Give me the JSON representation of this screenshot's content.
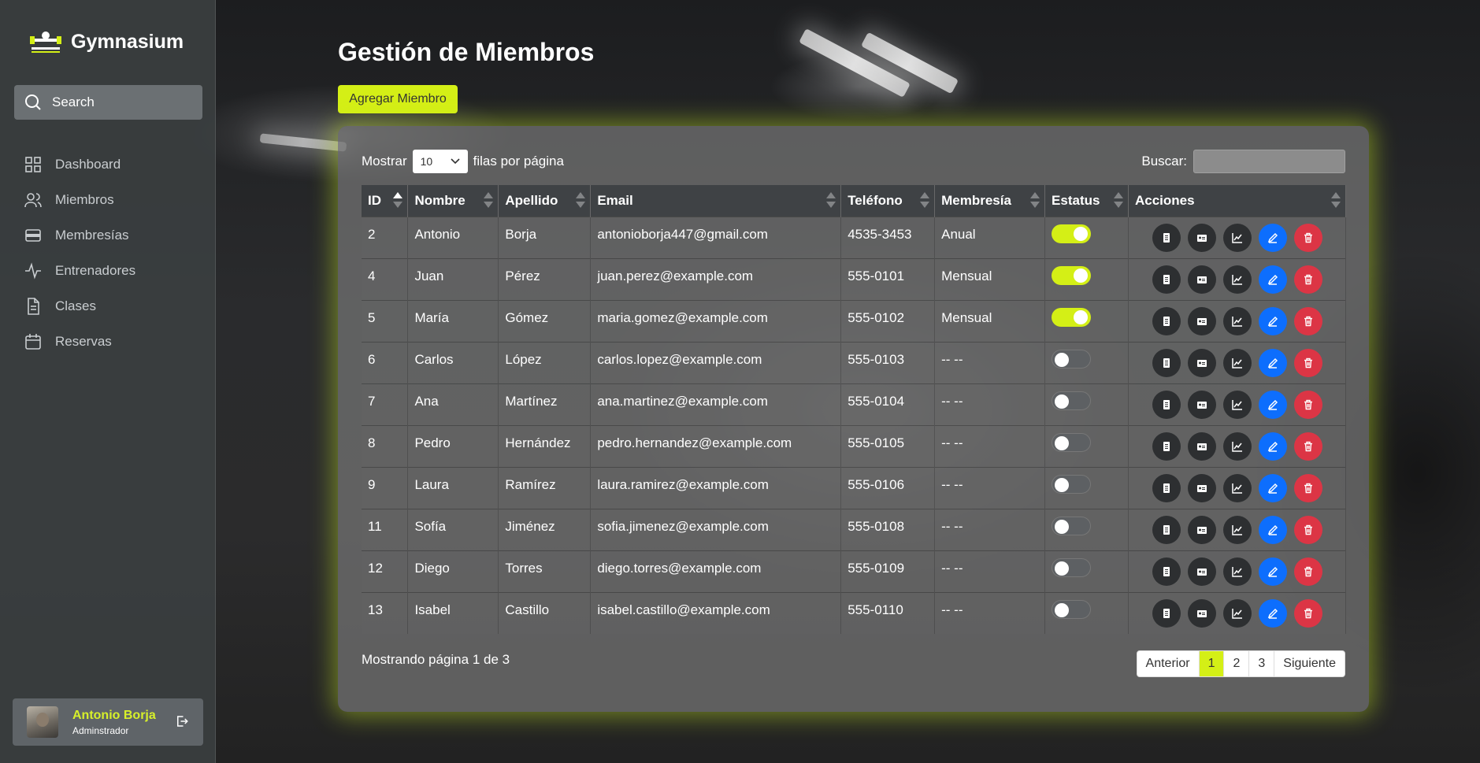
{
  "brand": {
    "name": "Gymnasium"
  },
  "sidebar": {
    "search_label": "Search",
    "items": [
      {
        "label": "Dashboard",
        "icon": "grid-icon"
      },
      {
        "label": "Miembros",
        "icon": "users-icon"
      },
      {
        "label": "Membresías",
        "icon": "card-icon"
      },
      {
        "label": "Entrenadores",
        "icon": "activity-icon"
      },
      {
        "label": "Clases",
        "icon": "document-icon"
      },
      {
        "label": "Reservas",
        "icon": "calendar-icon"
      }
    ]
  },
  "user": {
    "name": "Antonio Borja",
    "role": "Adminstrador"
  },
  "main": {
    "title": "Gestión de Miembros",
    "add_button": "Agregar Miembro",
    "show_prefix": "Mostrar",
    "show_value": "10",
    "show_suffix": "filas por página",
    "search_label": "Buscar:",
    "columns": [
      "ID",
      "Nombre",
      "Apellido",
      "Email",
      "Teléfono",
      "Membresía",
      "Estatus",
      "Acciones"
    ],
    "rows": [
      {
        "id": "2",
        "nombre": "Antonio",
        "apellido": "Borja",
        "email": "antonioborja447@gmail.com",
        "telefono": "4535-3453",
        "membresia": "Anual",
        "activo": true
      },
      {
        "id": "4",
        "nombre": "Juan",
        "apellido": "Pérez",
        "email": "juan.perez@example.com",
        "telefono": "555-0101",
        "membresia": "Mensual",
        "activo": true
      },
      {
        "id": "5",
        "nombre": "María",
        "apellido": "Gómez",
        "email": "maria.gomez@example.com",
        "telefono": "555-0102",
        "membresia": "Mensual",
        "activo": true
      },
      {
        "id": "6",
        "nombre": "Carlos",
        "apellido": "López",
        "email": "carlos.lopez@example.com",
        "telefono": "555-0103",
        "membresia": "-- --",
        "activo": false
      },
      {
        "id": "7",
        "nombre": "Ana",
        "apellido": "Martínez",
        "email": "ana.martinez@example.com",
        "telefono": "555-0104",
        "membresia": "-- --",
        "activo": false
      },
      {
        "id": "8",
        "nombre": "Pedro",
        "apellido": "Hernández",
        "email": "pedro.hernandez@example.com",
        "telefono": "555-0105",
        "membresia": "-- --",
        "activo": false
      },
      {
        "id": "9",
        "nombre": "Laura",
        "apellido": "Ramírez",
        "email": "laura.ramirez@example.com",
        "telefono": "555-0106",
        "membresia": "-- --",
        "activo": false
      },
      {
        "id": "11",
        "nombre": "Sofía",
        "apellido": "Jiménez",
        "email": "sofia.jimenez@example.com",
        "telefono": "555-0108",
        "membresia": "-- --",
        "activo": false
      },
      {
        "id": "12",
        "nombre": "Diego",
        "apellido": "Torres",
        "email": "diego.torres@example.com",
        "telefono": "555-0109",
        "membresia": "-- --",
        "activo": false
      },
      {
        "id": "13",
        "nombre": "Isabel",
        "apellido": "Castillo",
        "email": "isabel.castillo@example.com",
        "telefono": "555-0110",
        "membresia": "-- --",
        "activo": false
      }
    ],
    "page_info": "Mostrando página 1 de 3",
    "pagination": {
      "prev": "Anterior",
      "pages": [
        "1",
        "2",
        "3"
      ],
      "current": "1",
      "next": "Siguiente"
    }
  },
  "colors": {
    "accent": "#d4ef16",
    "blue": "#0d6efd",
    "red": "#dc3545"
  }
}
